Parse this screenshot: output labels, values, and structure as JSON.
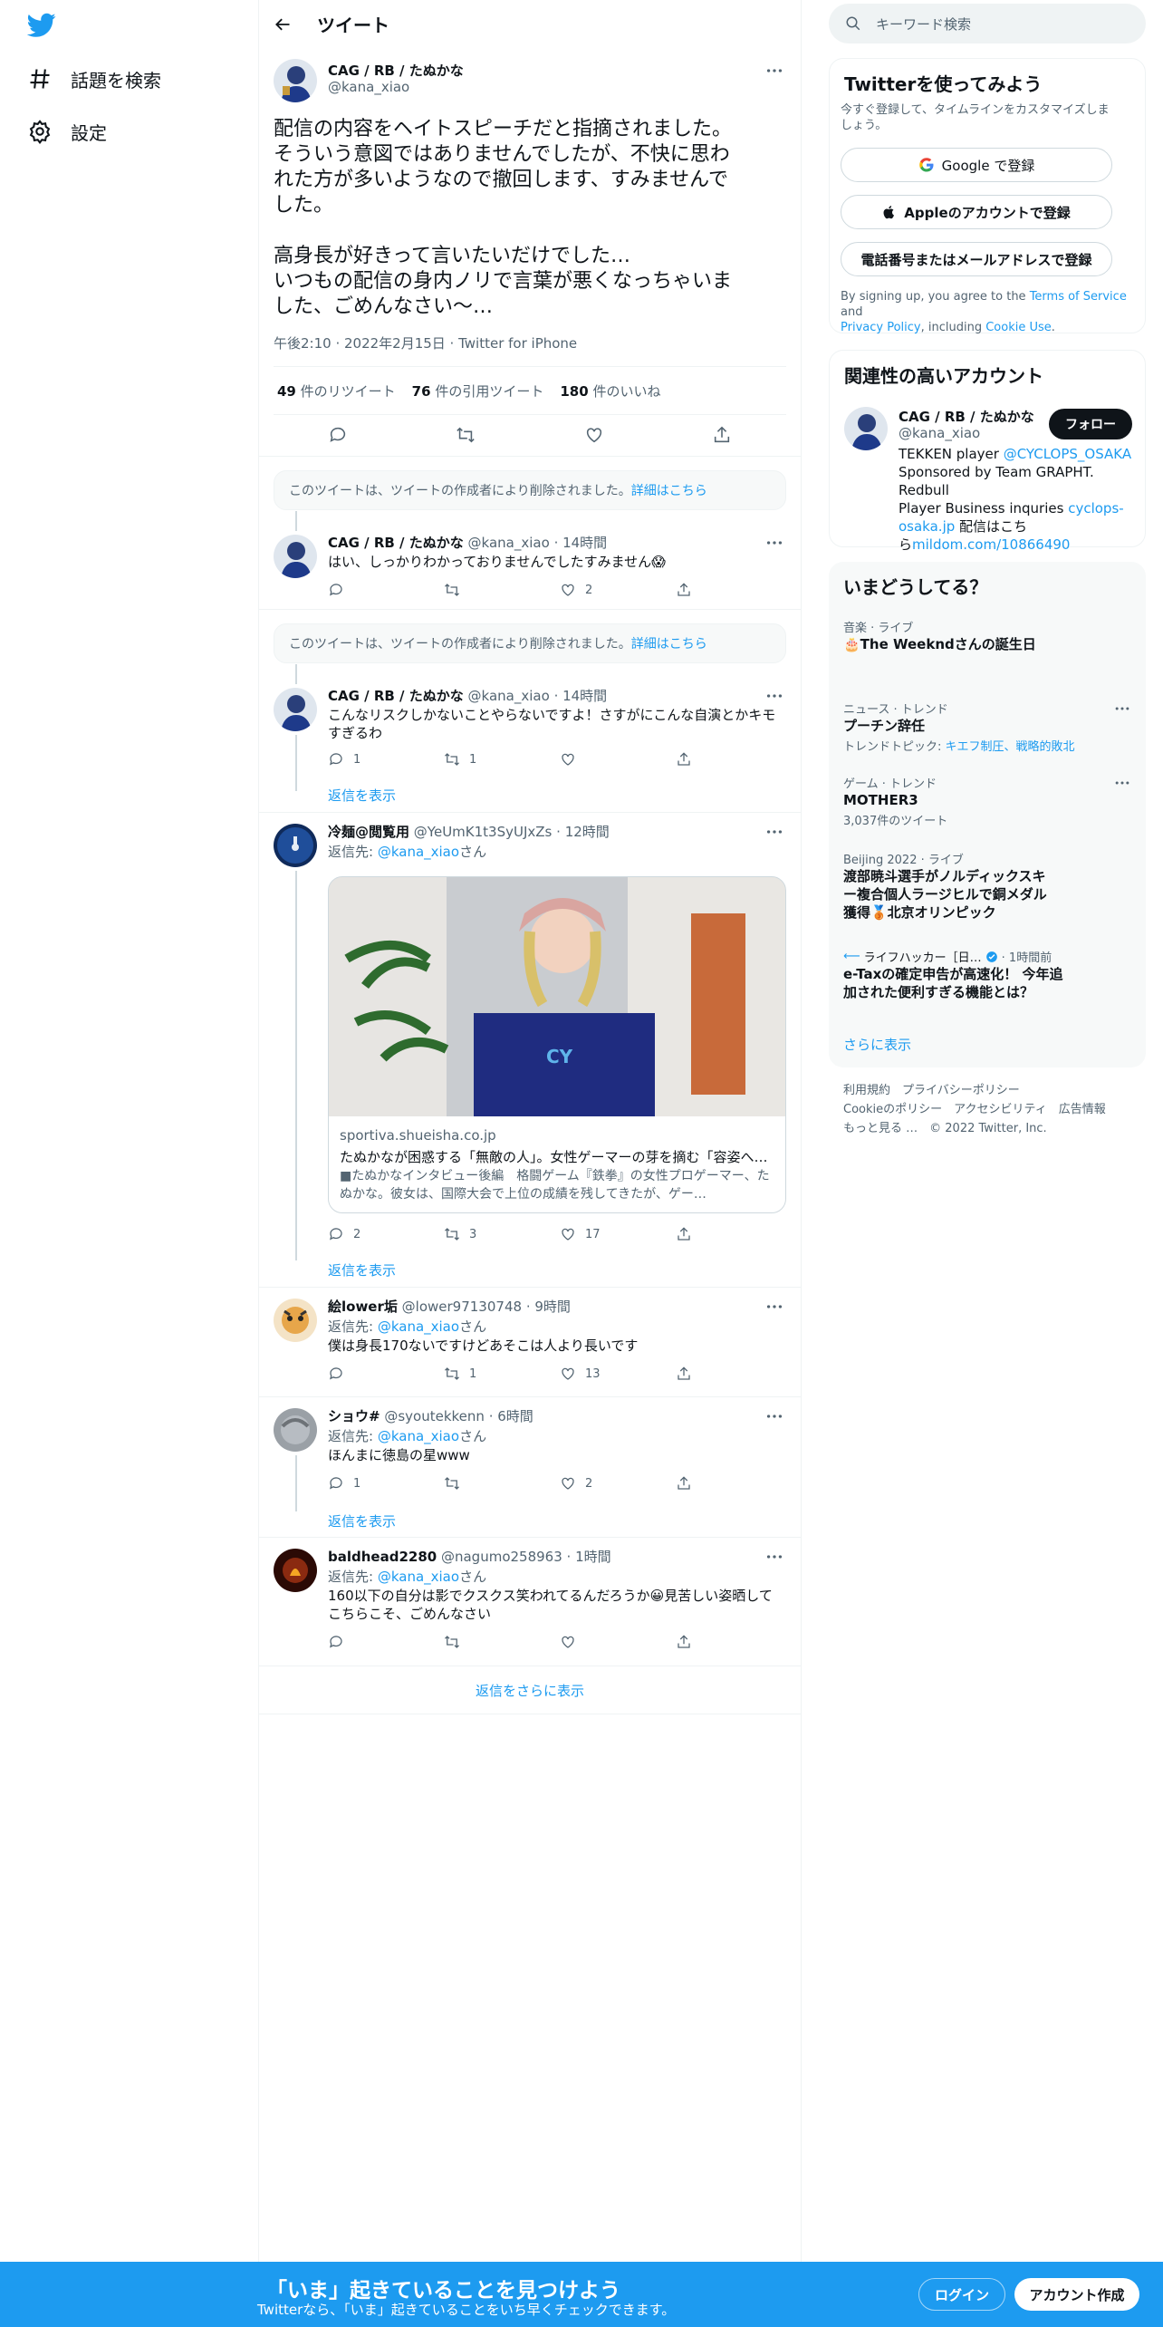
{
  "nav": {
    "explore_label": "話題を検索",
    "settings_label": "設定"
  },
  "header": {
    "title": "ツイート"
  },
  "main_tweet": {
    "name": "CAG / RB / たぬかな",
    "handle": "@kana_xiao",
    "text_lines": [
      "配信の内容をヘイトスピーチだと指摘されました。",
      "そういう意図ではありませんでしたが、不快に思わ",
      "れた方が多いようなので撤回します、すみませんで",
      "した。",
      "",
      "高身長が好きって言いたいだけでした…",
      "いつもの配信の身内ノリで言葉が悪くなっちゃいま",
      "した、ごめんなさい〜…"
    ],
    "meta": "午後2:10 · 2022年2月15日 · Twitter for iPhone",
    "retweets_count": "49",
    "retweets_label": "件のリツイート",
    "quotes_count": "76",
    "quotes_label": "件の引用ツイート",
    "likes_count": "180",
    "likes_label": "件のいいね"
  },
  "deleted_notice": {
    "text": "このツイートは、ツイートの作成者により削除されました。",
    "link": "詳細はこちら"
  },
  "replies": [
    {
      "name": "CAG / RB / たぬかな",
      "handle": "@kana_xiao",
      "time": "· 14時間",
      "text": "はい、しっかりわかっておりませんでしたすみません😱",
      "reply_count": "",
      "retweet_count": "",
      "like_count": "2"
    },
    {
      "name": "CAG / RB / たぬかな",
      "handle": "@kana_xiao",
      "time": "· 14時間",
      "text": "こんなリスクしかないことやらないですよ！さすがにこんな自演とかキモすぎるわ",
      "reply_count": "1",
      "retweet_count": "1",
      "like_count": ""
    },
    {
      "name": "冷麺@閲覧用",
      "handle": "@YeUmK1t3SyUJxZs",
      "time": "· 12時間",
      "reply_to": "返信先: ",
      "reply_to_handle": "@kana_xiao",
      "reply_to_suffix": "さん",
      "card": {
        "domain": "sportiva.shueisha.co.jp",
        "title": "たぬかなが困惑する「無敵の人」。女性ゲーマーの芽を摘む「容姿へ…",
        "desc": "■たぬかなインタビュー後編　格闘ゲーム『鉄拳』の女性プロゲーマー、たぬかな。彼女は、国際大会で上位の成績を残してきたが、ゲー…"
      },
      "reply_count": "2",
      "retweet_count": "3",
      "like_count": "17"
    },
    {
      "name": "絵lower垢",
      "handle": "@lower97130748",
      "time": "· 9時間",
      "reply_to": "返信先: ",
      "reply_to_handle": "@kana_xiao",
      "reply_to_suffix": "さん",
      "text": "僕は身長170ないですけどあそこは人より長いです",
      "reply_count": "",
      "retweet_count": "1",
      "like_count": "13"
    },
    {
      "name": "ショウ#",
      "handle": "@syoutekkenn",
      "time": "· 6時間",
      "reply_to": "返信先: ",
      "reply_to_handle": "@kana_xiao",
      "reply_to_suffix": "さん",
      "text": "ほんまに徳島の星www",
      "reply_count": "1",
      "retweet_count": "",
      "like_count": "2"
    },
    {
      "name": "baldhead2280",
      "handle": "@nagumo258963",
      "time": "· 1時間",
      "reply_to": "返信先: ",
      "reply_to_handle": "@kana_xiao",
      "reply_to_suffix": "さん",
      "text_lines": [
        "160以下の自分は影でクスクス笑われてるんだろうか😀見苦しい姿晒して",
        "こちらこそ、ごめんなさい"
      ],
      "reply_count": "",
      "retweet_count": "",
      "like_count": ""
    }
  ],
  "show_replies_label": "返信を表示",
  "more_replies_label": "返信をさらに表示",
  "search": {
    "placeholder": "キーワード検索"
  },
  "signup": {
    "title": "Twitterを使ってみよう",
    "subtitle_lines": [
      "今すぐ登録して、タイムラインをカスタマイズしま",
      "しょう。"
    ],
    "google": "Google で登録",
    "apple": "Appleのアカウントで登録",
    "phone": "電話番号またはメールアドレスで登録",
    "terms_pre": "By signing up, you agree to the ",
    "terms_link": "Terms of Service",
    "terms_and": " and",
    "privacy_link": "Privacy Policy",
    "including": ", including ",
    "cookie_link": "Cookie Use",
    "period": "."
  },
  "relevant": {
    "title": "関連性の高いアカウント",
    "name": "CAG / RB / たぬかな",
    "handle": "@kana_xiao",
    "follow": "フォロー",
    "bio_1": "TEKKEN player ",
    "bio_link1": "@CYCLOPS_OSAKA",
    "bio_2": "Sponsored by Team GRAPHT. Redbull",
    "bio_3": "Player Business inquries ",
    "bio_link2": "cyclops-",
    "bio_link2b": "osaka.jp",
    "bio_4": " 配信はこち",
    "bio_5": "ら",
    "bio_link3": "mildom.com/10866490"
  },
  "trends": {
    "title": "いまどうしてる？",
    "items": [
      {
        "category": "音楽 · ライブ",
        "name": "🎂The Weekndさんの誕生日"
      },
      {
        "category": "ニュース · トレンド",
        "name": "プーチン辞任",
        "topics_label": "トレンドトピック: ",
        "topics": "キエフ制圧、戦略的敗北"
      },
      {
        "category": "ゲーム · トレンド",
        "name": "MOTHER3",
        "count": "3,037件のツイート"
      },
      {
        "category": "Beijing 2022 · ライブ",
        "name_lines": [
          "渡部暁斗選手がノルディックスキ",
          "ー複合個人ラージヒルで銅メダル",
          "獲得🥉北京オリンピック"
        ]
      },
      {
        "category": "ライフハッカー［日…",
        "time": "· 1時間前",
        "name_lines": [
          "e-Taxの確定申告が高速化！ 今年追",
          "加された便利すぎる機能とは？"
        ]
      }
    ],
    "show_more": "さらに表示"
  },
  "footer": {
    "terms": "利用規約",
    "privacy": "プライバシーポリシー",
    "cookie": "Cookieのポリシー",
    "accessibility": "アクセシビリティ",
    "ads": "広告情報",
    "more": "もっと見る …",
    "copyright": "© 2022 Twitter, Inc."
  },
  "bottom": {
    "title": "「いま」起きていることを見つけよう",
    "subtitle": "Twitterなら、「いま」起きていることをいち早くチェックできます。",
    "login": "ログイン",
    "signup": "アカウント作成"
  },
  "colors": {
    "accent": "#1d9bf0",
    "text": "#0f1419",
    "muted": "#536471",
    "bottom_bar": "#1d9bf0"
  }
}
